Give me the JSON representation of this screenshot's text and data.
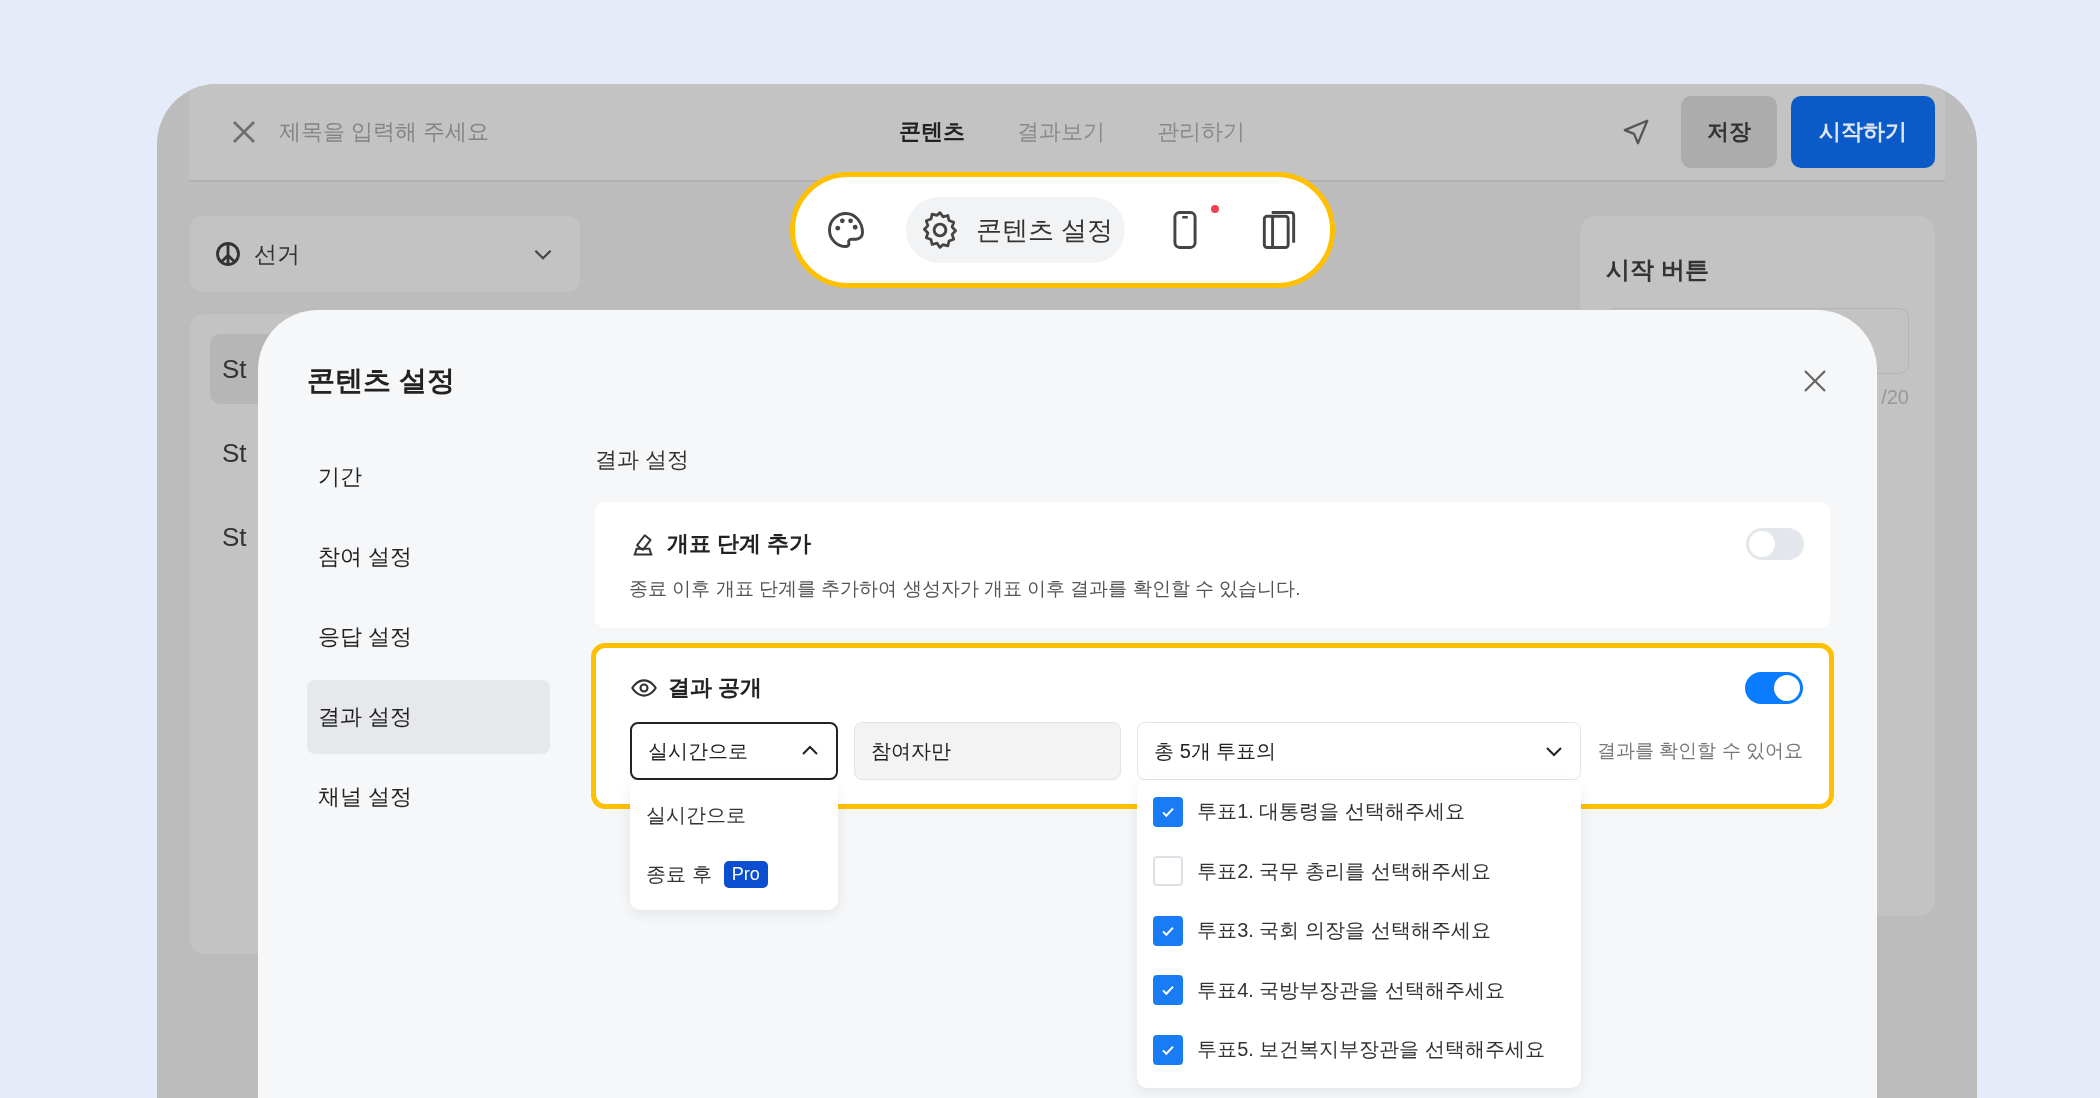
{
  "editor": {
    "title_placeholder": "제목을 입력해 주세요",
    "tabs": [
      {
        "label": "콘텐츠",
        "selected": true
      },
      {
        "label": "결과보기",
        "selected": false
      },
      {
        "label": "관리하기",
        "selected": false
      }
    ],
    "save_label": "저장",
    "start_label": "시작하기"
  },
  "toolbar": {
    "items": [
      {
        "kind": "palette",
        "selected": false
      },
      {
        "kind": "settings",
        "label": "콘텐츠 설정",
        "selected": true
      },
      {
        "kind": "phone",
        "selected": false,
        "badge": true
      },
      {
        "kind": "book",
        "selected": false
      }
    ]
  },
  "left_panel": {
    "category": "선거",
    "items": [
      {
        "label": "St",
        "selected": true
      },
      {
        "label": "St",
        "selected": false
      },
      {
        "label": "St",
        "selected": false
      }
    ]
  },
  "right_panel": {
    "title": "시작 버튼",
    "counter": "/20"
  },
  "modal": {
    "title": "콘텐츠 설정",
    "nav": [
      {
        "label": "기간",
        "selected": false
      },
      {
        "label": "참여 설정",
        "selected": false
      },
      {
        "label": "응답 설정",
        "selected": false
      },
      {
        "label": "결과 설정",
        "selected": true
      },
      {
        "label": "채널 설정",
        "selected": false
      }
    ],
    "section_title": "결과 설정",
    "settings": [
      {
        "kind": "stage",
        "title": "개표 단계 추가",
        "description": "종료 이후 개표 단계를 추가하여 생성자가 개표 이후 결과를 확인할 수 있습니다.",
        "on": false,
        "highlighted": false
      },
      {
        "kind": "reveal",
        "title": "결과 공개",
        "on": true,
        "highlighted": true,
        "timing": {
          "value": "실시간으로",
          "expanded": true,
          "options": [
            {
              "label": "실시간으로"
            },
            {
              "label": "종료 후",
              "badge": "Pro"
            }
          ]
        },
        "audience": {
          "value": "참여자만",
          "disabled": true
        },
        "votes": {
          "value": "총 5개 투표의",
          "expanded": true,
          "options": [
            {
              "label": "투표1. 대통령을 선택해주세요",
              "checked": true
            },
            {
              "label": "투표2. 국무 총리를 선택해주세요",
              "checked": false
            },
            {
              "label": "투표3. 국회 의장을 선택해주세요",
              "checked": true
            },
            {
              "label": "투표4. 국방부장관을 선택해주세요",
              "checked": true
            },
            {
              "label": "투표5. 보건복지부장관을 선택해주세요",
              "checked": true
            }
          ]
        },
        "suffix": "결과를 확인할 수 있어요"
      }
    ]
  }
}
